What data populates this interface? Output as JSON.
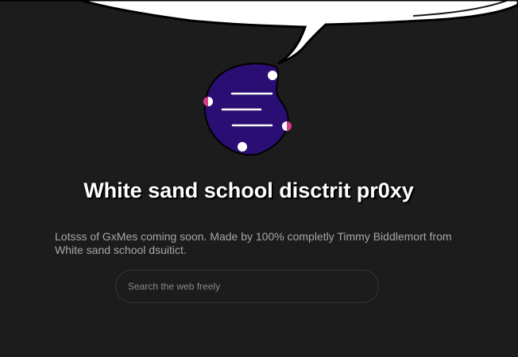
{
  "hero": {
    "title": "White sand school disctrit pr0xy",
    "description": "Lotsss of GxMes coming soon. Made by 100% completly Timmy Biddlemort from White sand school dsuitict."
  },
  "search": {
    "placeholder": "Search the web freely",
    "value": ""
  },
  "logo": {
    "icon": "menu-blob-logo-icon"
  },
  "colors": {
    "background": "#1c1c1c",
    "logo_fill": "#2b0e73",
    "accent_pink": "#d63c8c",
    "text_muted": "#a6a6a6"
  }
}
